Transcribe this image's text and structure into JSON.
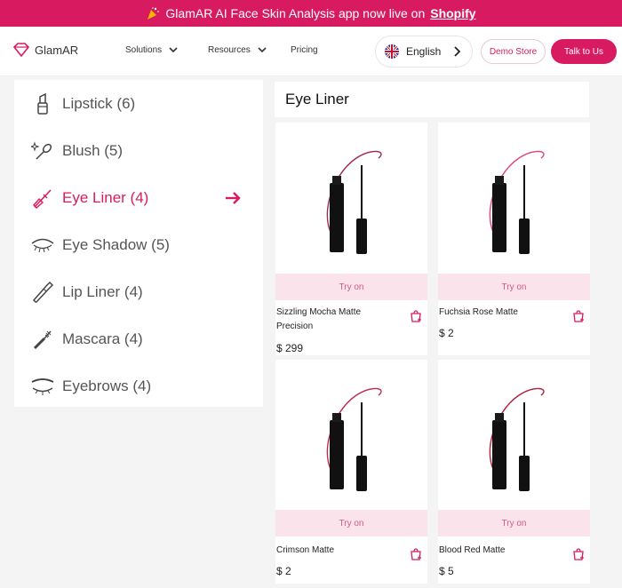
{
  "banner": {
    "text": "GlamAR AI Face Skin Analysis app now live on",
    "link": "Shopify",
    "icon": "party-popper-icon"
  },
  "nav": {
    "logo": "GlamAR",
    "solutions": "Solutions",
    "resources": "Resources",
    "pricing": "Pricing",
    "language": "English",
    "demo_store": "Demo Store",
    "talk": "Talk to Us"
  },
  "sidebar": {
    "items": [
      {
        "label": "Lipstick (6)",
        "icon": "lipstick-icon"
      },
      {
        "label": "Blush (5)",
        "icon": "blush-brush-icon"
      },
      {
        "label": "Eye Liner (4)",
        "icon": "eyeliner-icon",
        "active": true
      },
      {
        "label": "Eye Shadow (5)",
        "icon": "eye-shadow-icon"
      },
      {
        "label": "Lip Liner (4)",
        "icon": "lip-liner-icon"
      },
      {
        "label": "Mascara (4)",
        "icon": "mascara-icon"
      },
      {
        "label": "Eyebrows (4)",
        "icon": "eyebrow-icon"
      }
    ]
  },
  "main": {
    "title": "Eye Liner",
    "products": [
      {
        "name": "Sizzling Mocha Matte Precision",
        "price": "$ 299",
        "try": "Try on"
      },
      {
        "name": "Fuchsia Rose Matte",
        "price": "$ 2",
        "try": "Try on"
      },
      {
        "name": "Crimson Matte",
        "price": "$ 2",
        "try": "Try on"
      },
      {
        "name": "Blood Red Matte",
        "price": "$ 5",
        "try": "Try on"
      }
    ]
  },
  "colors": {
    "brand": "#d81b60",
    "try_bg": "#fbe3ec"
  }
}
